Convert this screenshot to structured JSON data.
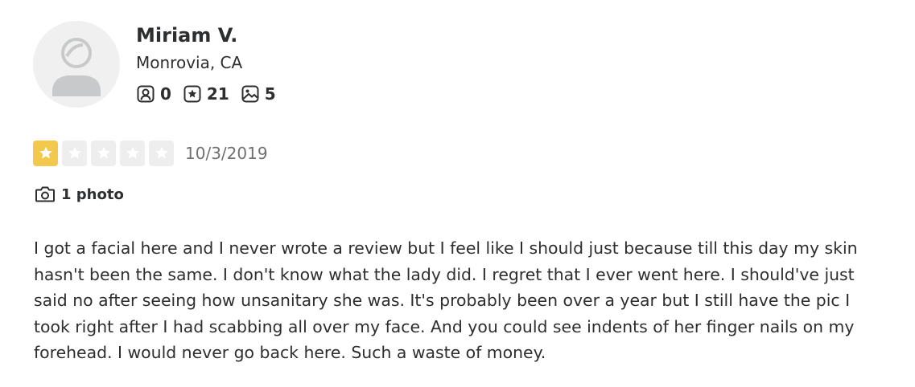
{
  "reviewer": {
    "name": "Miriam V.",
    "location": "Monrovia, CA",
    "stats": {
      "friends": "0",
      "reviews": "21",
      "photos": "5"
    }
  },
  "review": {
    "rating": 1,
    "max_rating": 5,
    "date": "10/3/2019",
    "photo_label": "1 photo",
    "text": "I got a facial here and I never wrote a review but I feel like I should just because till this day my skin\nhasn't been the same.  I don't know what the lady did. I regret that I ever went here.  I should've just\nsaid no after seeing how unsanitary she was.  It's probably been over a year but I still have the pic I\ntook right after I had scabbing all over my face.  And you could see indents of her finger nails on my\nforehead.    I would never go back here.  Such a waste of money."
  },
  "colors": {
    "star_filled": "#f2c94c",
    "star_empty": "#eeeeee",
    "text": "#2d2e2f",
    "date": "#6e7072",
    "avatar_bg": "#f0f0f0"
  },
  "icons": {
    "friends": "friends-icon",
    "reviews": "review-star-icon",
    "photos": "photo-icon",
    "camera": "camera-icon"
  }
}
